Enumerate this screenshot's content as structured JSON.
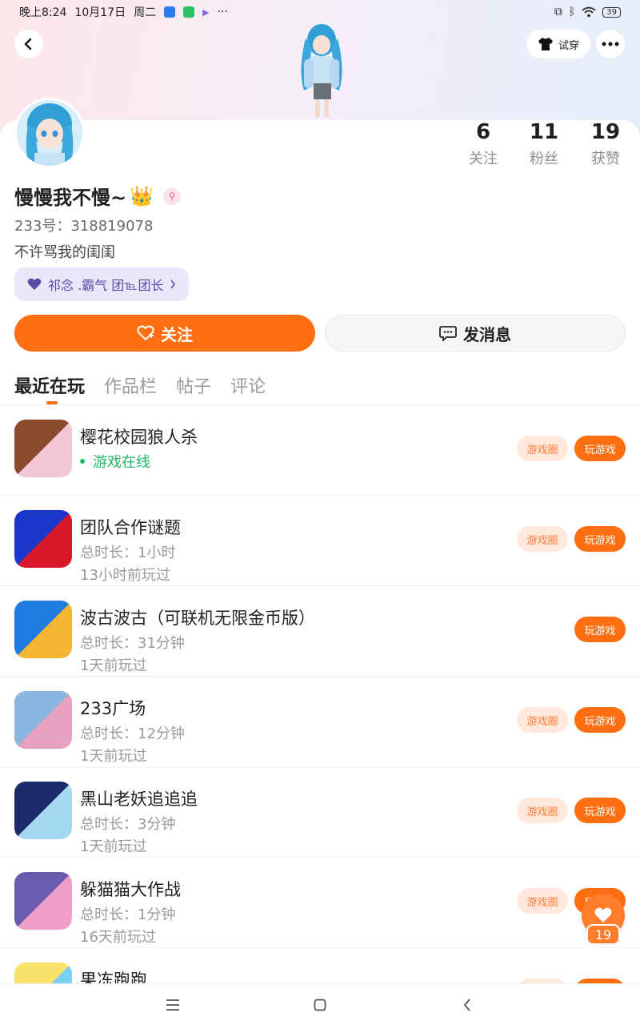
{
  "status_bar": {
    "time": "晚上8:24",
    "date": "10月17日",
    "weekday": "周二",
    "more": "···",
    "battery": "39"
  },
  "header": {
    "tryon_label": "试穿"
  },
  "profile": {
    "stats": [
      {
        "num": "6",
        "label": "关注"
      },
      {
        "num": "11",
        "label": "粉丝"
      },
      {
        "num": "19",
        "label": "获赞"
      }
    ],
    "name": "慢慢我不慢~",
    "crown": "👑",
    "uid": "233号：318819078",
    "bio": "不许骂我的闺闺",
    "group": "祁念   .霸气 团℡团长"
  },
  "actions": {
    "follow": "关注",
    "message": "发消息"
  },
  "tabs": [
    "最近在玩",
    "作品栏",
    "帖子",
    "评论"
  ],
  "games": [
    {
      "title": "樱花校园狼人杀",
      "line1": "游戏在线",
      "line2": "",
      "online": true,
      "circle": "游戏圈",
      "play": "玩游戏",
      "colors": [
        "#8b4a2e",
        "#f2c6d6"
      ]
    },
    {
      "title": "团队合作谜题",
      "line1": "总时长：1小时",
      "line2": "13小时前玩过",
      "online": false,
      "circle": "游戏圈",
      "play": "玩游戏",
      "colors": [
        "#1b35c8",
        "#d8182a"
      ]
    },
    {
      "title": "波古波古（可联机无限金币版）",
      "line1": "总时长：31分钟",
      "line2": "1天前玩过",
      "online": false,
      "circle": "",
      "play": "玩游戏",
      "colors": [
        "#1f7be0",
        "#f2b630"
      ]
    },
    {
      "title": "233广场",
      "line1": "总时长：12分钟",
      "line2": "1天前玩过",
      "online": false,
      "circle": "游戏圈",
      "play": "玩游戏",
      "colors": [
        "#8bb6e0",
        "#e6a0c0"
      ]
    },
    {
      "title": "黑山老妖追追追",
      "line1": "总时长：3分钟",
      "line2": "1天前玩过",
      "online": false,
      "circle": "游戏圈",
      "play": "玩游戏",
      "colors": [
        "#1a2a6a",
        "#a4d8f0"
      ]
    },
    {
      "title": "躲猫猫大作战",
      "line1": "总时长：1分钟",
      "line2": "16天前玩过",
      "online": false,
      "circle": "游戏圈",
      "play": "玩游戏",
      "colors": [
        "#6a5ab0",
        "#f0a0c8"
      ]
    },
    {
      "title": "果冻跑跑",
      "line1": "",
      "line2": "",
      "online": false,
      "circle": "游戏圈",
      "play": "玩游戏",
      "colors": [
        "#f7e36a",
        "#7ad0f0"
      ]
    }
  ],
  "floating": {
    "count": "19"
  },
  "colors": {
    "accent": "#ff6f12",
    "online": "#1fb768",
    "chip_bg": "#ebe7fb"
  }
}
